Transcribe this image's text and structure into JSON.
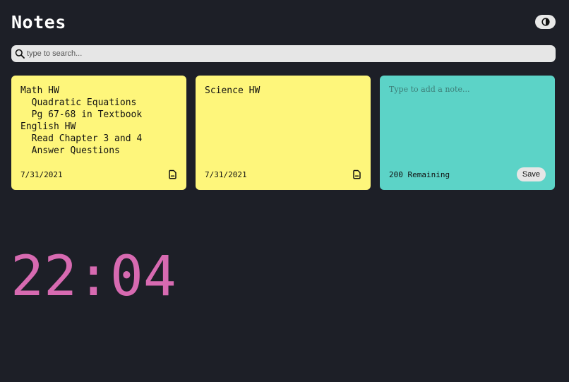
{
  "header": {
    "title": "Notes",
    "theme_toggle_icon": "contrast-icon"
  },
  "search": {
    "placeholder": "type to search...",
    "value": "",
    "icon": "search-icon"
  },
  "notes": [
    {
      "text": "Math HW\n  Quadratic Equations\n  Pg 67-68 in Textbook\nEnglish HW\n  Read Chapter 3 and 4\n  Answer Questions",
      "date": "7/31/2021",
      "delete_icon": "delete-note-icon"
    },
    {
      "text": "Science HW",
      "date": "7/31/2021",
      "delete_icon": "delete-note-icon"
    }
  ],
  "new_note": {
    "placeholder": "Type to add a note...",
    "value": "",
    "remaining": "200 Remaining",
    "save_label": "Save"
  },
  "clock": {
    "time": "22:04"
  },
  "colors": {
    "background": "#1d1f27",
    "note": "#fef67b",
    "new_note": "#5cd3c7",
    "clock": "#d76ab1"
  }
}
